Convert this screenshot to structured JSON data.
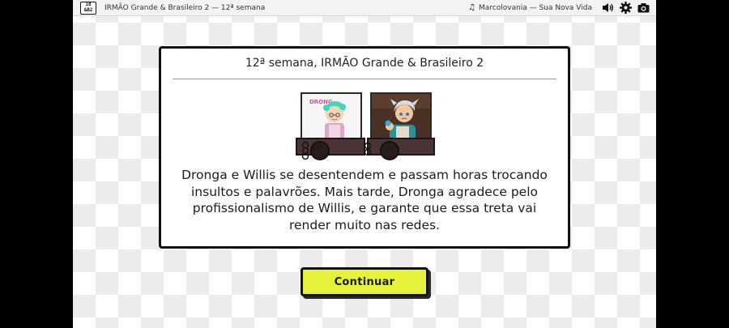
{
  "header": {
    "title": "IRMÃO Grande & Brasileiro 2 — 12ª semana",
    "song": "Marcolovania — Sua Nova Vida",
    "logo_line1": "10",
    "logo_line2": "&B2"
  },
  "event": {
    "title": "12ª semana, IRMÃO Grande & Brasileiro 2",
    "description": "Dronga e Willis se desentendem e passam horas trocando insultos e palavrões. Mais tarde, Dronga agradece pelo profissionalismo de Willis, e garante que essa treta vai render muito nas redes.",
    "portrait_1_label": "DRONG"
  },
  "actions": {
    "continue_label": "Continuar"
  },
  "icons": [
    "music-note-icon",
    "volume-icon",
    "settings-gear-icon",
    "camera-icon"
  ],
  "colors": {
    "continue_button": "#e6f23a",
    "cart": "#4a3436",
    "panel_border": "#111111"
  }
}
